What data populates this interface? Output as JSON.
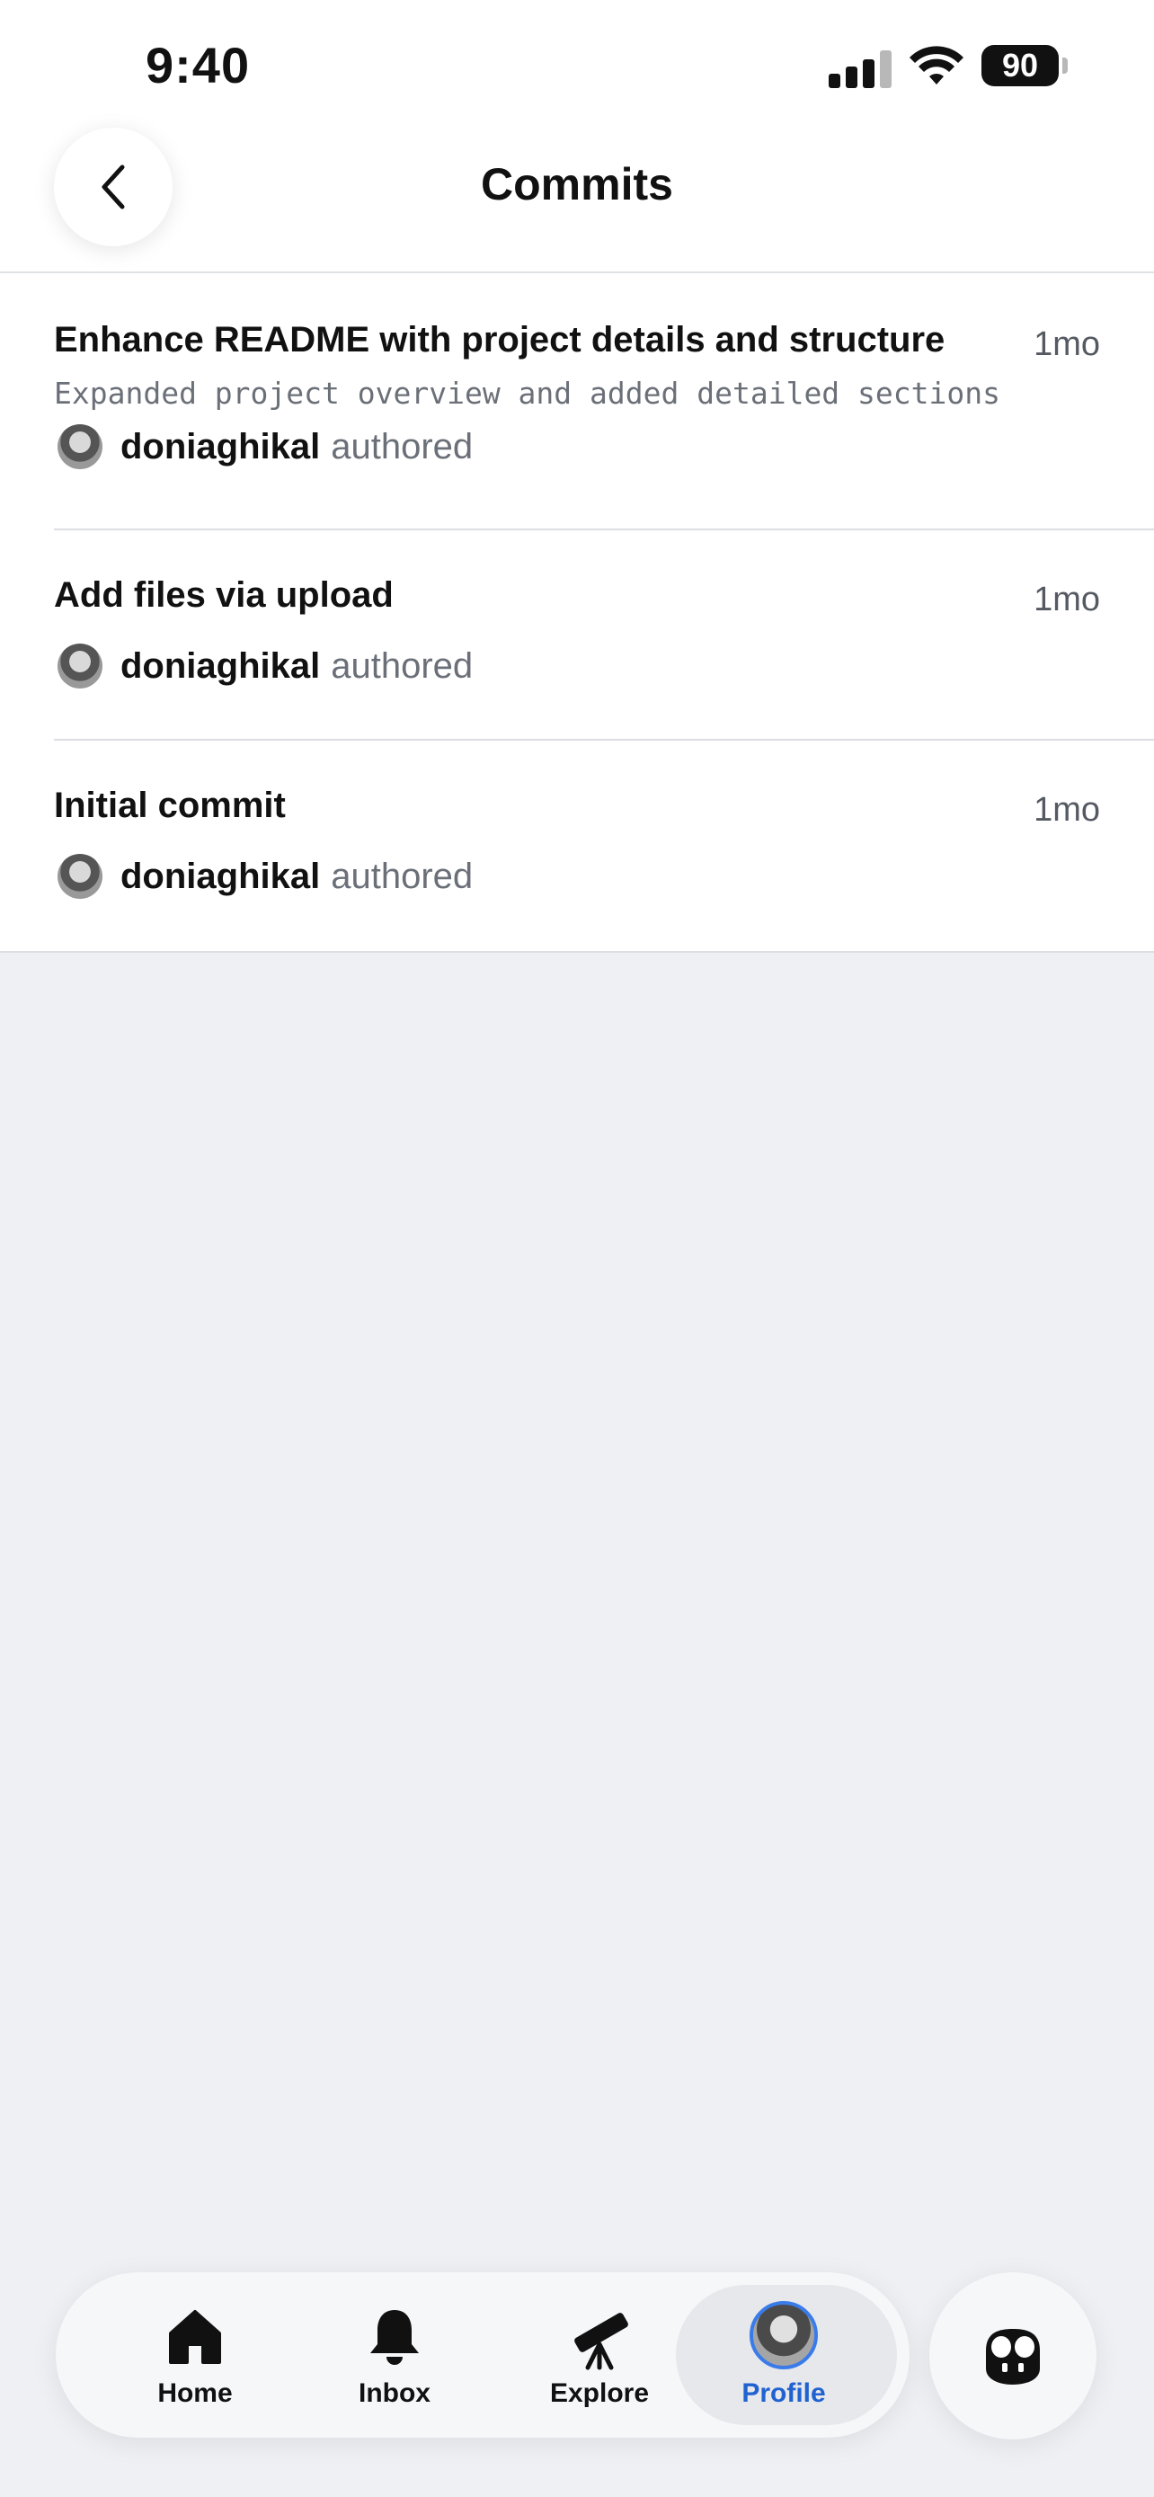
{
  "status_bar": {
    "time": "9:40",
    "battery": "90"
  },
  "header": {
    "title": "Commits"
  },
  "commits": [
    {
      "title": "Enhance README with project details and structure",
      "description": "Expanded project overview and added detailed sections",
      "time": "1mo",
      "author": "doniaghikal",
      "action": "authored"
    },
    {
      "title": "Add files via upload",
      "time": "1mo",
      "author": "doniaghikal",
      "action": "authored"
    },
    {
      "title": "Initial commit",
      "time": "1mo",
      "author": "doniaghikal",
      "action": "authored"
    }
  ],
  "tabbar": {
    "items": [
      {
        "label": "Home",
        "icon": "home-icon"
      },
      {
        "label": "Inbox",
        "icon": "bell-icon"
      },
      {
        "label": "Explore",
        "icon": "telescope-icon"
      },
      {
        "label": "Profile",
        "icon": "avatar",
        "active": true
      }
    ],
    "copilot_icon": "copilot-icon"
  },
  "colors": {
    "accent": "#1f62d0",
    "background": "#eef0f4"
  }
}
